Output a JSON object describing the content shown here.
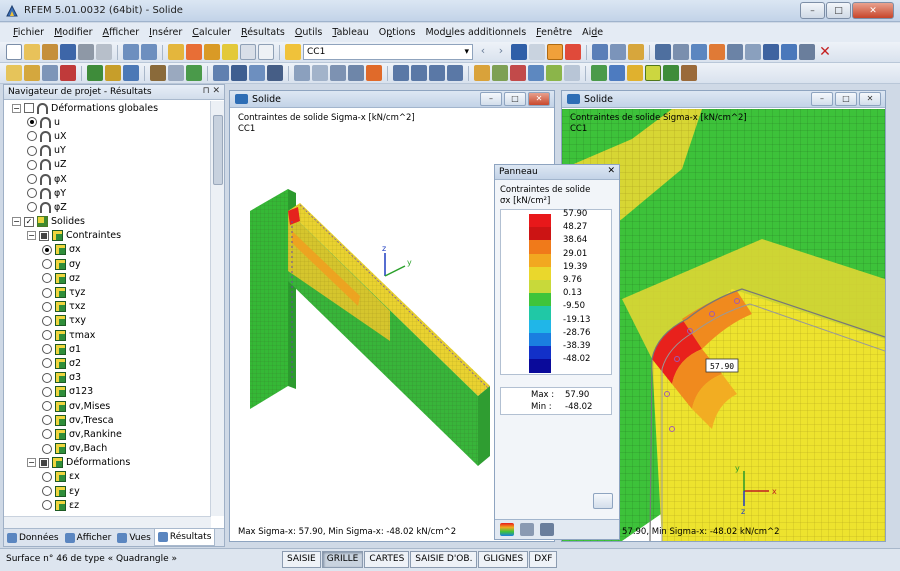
{
  "window": {
    "title": "RFEM 5.01.0032 (64bit) - Solide",
    "minimize": "–",
    "maximize": "□",
    "close": "✕"
  },
  "menu": [
    {
      "pre": "",
      "ul": "F",
      "post": "ichier"
    },
    {
      "pre": "",
      "ul": "M",
      "post": "odifier"
    },
    {
      "pre": "",
      "ul": "A",
      "post": "fficher"
    },
    {
      "pre": "",
      "ul": "I",
      "post": "nsérer"
    },
    {
      "pre": "",
      "ul": "C",
      "post": "alculer"
    },
    {
      "pre": "",
      "ul": "R",
      "post": "ésultats"
    },
    {
      "pre": "",
      "ul": "O",
      "post": "utils"
    },
    {
      "pre": "",
      "ul": "T",
      "post": "ableau"
    },
    {
      "pre": "O",
      "ul": "p",
      "post": "tions"
    },
    {
      "pre": "Mod",
      "ul": "u",
      "post": "les additionnels"
    },
    {
      "pre": "",
      "ul": "F",
      "post": "enêtre"
    },
    {
      "pre": "Ai",
      "ul": "d",
      "post": "e"
    }
  ],
  "toolbar": {
    "load_case": "CC1"
  },
  "navigator": {
    "title": "Navigateur de projet - Résultats",
    "pin": "⊓ ✕",
    "tree": [
      {
        "level": 0,
        "exp": "−",
        "chk": "none",
        "icon": "def",
        "label": "Déformations globales"
      },
      {
        "level": 1,
        "radio": true,
        "on": true,
        "icon": "def",
        "label": "u"
      },
      {
        "level": 1,
        "radio": true,
        "on": false,
        "icon": "def",
        "label": "uX"
      },
      {
        "level": 1,
        "radio": true,
        "on": false,
        "icon": "def",
        "label": "uY"
      },
      {
        "level": 1,
        "radio": true,
        "on": false,
        "icon": "def",
        "label": "uZ"
      },
      {
        "level": 1,
        "radio": true,
        "on": false,
        "icon": "def",
        "label": "φX"
      },
      {
        "level": 1,
        "radio": true,
        "on": false,
        "icon": "def",
        "label": "φY"
      },
      {
        "level": 1,
        "radio": true,
        "on": false,
        "icon": "def",
        "label": "φZ"
      },
      {
        "level": 0,
        "exp": "−",
        "chk": "checked",
        "icon": "solid",
        "label": "Solides"
      },
      {
        "level": 1,
        "exp": "−",
        "chk": "partial",
        "icon": "stress",
        "label": "Contraintes"
      },
      {
        "level": 2,
        "radio": true,
        "on": true,
        "icon": "stress",
        "label": "σx"
      },
      {
        "level": 2,
        "radio": true,
        "on": false,
        "icon": "stress",
        "label": "σy"
      },
      {
        "level": 2,
        "radio": true,
        "on": false,
        "icon": "stress",
        "label": "σz"
      },
      {
        "level": 2,
        "radio": true,
        "on": false,
        "icon": "stress",
        "label": "τyz"
      },
      {
        "level": 2,
        "radio": true,
        "on": false,
        "icon": "stress",
        "label": "τxz"
      },
      {
        "level": 2,
        "radio": true,
        "on": false,
        "icon": "stress",
        "label": "τxy"
      },
      {
        "level": 2,
        "radio": true,
        "on": false,
        "icon": "stress",
        "label": "τmax"
      },
      {
        "level": 2,
        "radio": true,
        "on": false,
        "icon": "stress",
        "label": "σ1"
      },
      {
        "level": 2,
        "radio": true,
        "on": false,
        "icon": "stress",
        "label": "σ2"
      },
      {
        "level": 2,
        "radio": true,
        "on": false,
        "icon": "stress",
        "label": "σ3"
      },
      {
        "level": 2,
        "radio": true,
        "on": false,
        "icon": "stress",
        "label": "σ123"
      },
      {
        "level": 2,
        "radio": true,
        "on": false,
        "icon": "stress",
        "label": "σv,Mises"
      },
      {
        "level": 2,
        "radio": true,
        "on": false,
        "icon": "stress",
        "label": "σv,Tresca"
      },
      {
        "level": 2,
        "radio": true,
        "on": false,
        "icon": "stress",
        "label": "σv,Rankine"
      },
      {
        "level": 2,
        "radio": true,
        "on": false,
        "icon": "stress",
        "label": "σv,Bach"
      },
      {
        "level": 1,
        "exp": "−",
        "chk": "partial",
        "icon": "stress",
        "label": "Déformations"
      },
      {
        "level": 2,
        "radio": true,
        "on": false,
        "icon": "stress",
        "label": "εx"
      },
      {
        "level": 2,
        "radio": true,
        "on": false,
        "icon": "stress",
        "label": "εy"
      },
      {
        "level": 2,
        "radio": true,
        "on": false,
        "icon": "stress",
        "label": "εz"
      }
    ],
    "tabs": [
      "Données",
      "Afficher",
      "Vues",
      "Résultats"
    ],
    "active_tab": 3
  },
  "window1": {
    "title": "Solide",
    "result_line1": "Contraintes de solide Sigma-x [kN/cm^2]",
    "result_line2": "CC1",
    "footer": "Max Sigma-x: 57.90, Min Sigma-x: -48.02 kN/cm^2",
    "axes": {
      "z": "z",
      "y": "y"
    }
  },
  "window2": {
    "title": "Solide",
    "result_line1": "Contraintes de solide Sigma-x [kN/cm^2]",
    "result_line2": "CC1",
    "footer": "57.90, Min Sigma-x: -48.02 kN/cm^2",
    "max_label": "57.90",
    "axes": {
      "x": "x",
      "y": "y",
      "z": "z"
    }
  },
  "panel": {
    "title": "Panneau",
    "close": "✕",
    "heading1": "Contraintes de solide",
    "heading2": "σx [kN/cm²]",
    "scale": [
      {
        "value": "57.90",
        "color": "#e8181a"
      },
      {
        "value": "48.27",
        "color": "#cc1414"
      },
      {
        "value": "38.64",
        "color": "#f07a1a"
      },
      {
        "value": "29.01",
        "color": "#f2a820"
      },
      {
        "value": "19.39",
        "color": "#ead72c"
      },
      {
        "value": "9.76",
        "color": "#c8d93a"
      },
      {
        "value": "0.13",
        "color": "#3fc43a"
      },
      {
        "value": "-9.50",
        "color": "#20c8a6"
      },
      {
        "value": "-19.13",
        "color": "#20b6e8"
      },
      {
        "value": "-28.76",
        "color": "#1a7ee0"
      },
      {
        "value": "-38.39",
        "color": "#1230c8"
      },
      {
        "value": "-48.02",
        "color": "#0a0a9a"
      }
    ],
    "max_label": "Max :",
    "max_value": "57.90",
    "min_label": "Min :",
    "min_value": "-48.02"
  },
  "status": {
    "text": "Surface n° 46 de type « Quadrangle »",
    "buttons": [
      "SAISIE",
      "GRILLE",
      "CARTES",
      "SAISIE D'OB.",
      "GLIGNES",
      "DXF"
    ],
    "active": [
      1
    ]
  }
}
